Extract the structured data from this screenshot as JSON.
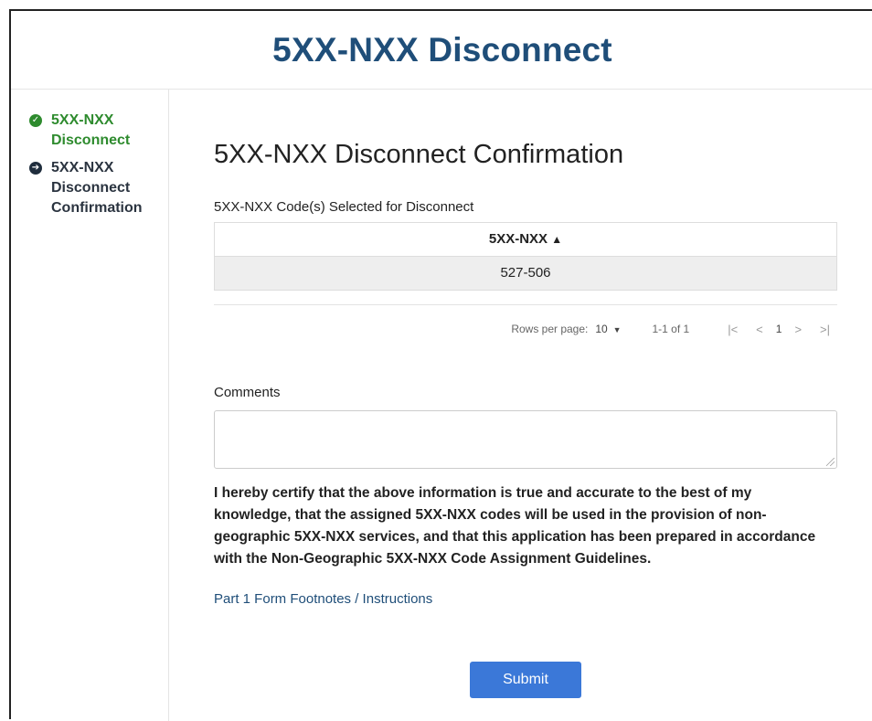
{
  "header": {
    "title": "5XX-NXX Disconnect"
  },
  "sidebar": {
    "steps": [
      {
        "label": "5XX-NXX Disconnect",
        "status": "complete",
        "icon": "check-circle-icon"
      },
      {
        "label": "5XX-NXX Disconnect Confirmation",
        "status": "current",
        "icon": "arrow-circle-icon"
      }
    ]
  },
  "main": {
    "title": "5XX-NXX Disconnect Confirmation",
    "codes_label": "5XX-NXX Code(s) Selected for Disconnect",
    "table": {
      "column_header": "5XX-NXX",
      "sort_indicator": "▲",
      "rows": [
        "527-506"
      ]
    },
    "pagination": {
      "rows_per_page_label": "Rows per page:",
      "rows_per_page_value": "10",
      "range": "1-1 of 1",
      "current_page": "1"
    },
    "comments": {
      "label": "Comments",
      "value": ""
    },
    "certification": "I hereby certify that the above information is true and accurate to the best of my knowledge, that the assigned 5XX-NXX codes will be used in the provision of non-geographic 5XX-NXX services, and that this application has been prepared in accordance with the Non-Geographic 5XX-NXX Code Assignment Guidelines.",
    "footnotes_link": "Part 1 Form Footnotes / Instructions",
    "submit_label": "Submit"
  },
  "colors": {
    "title": "#1f4e79",
    "step_complete": "#2e8b2e",
    "step_current": "#2b3440",
    "link": "#1f4e79",
    "submit_button": "#3b78d8"
  }
}
